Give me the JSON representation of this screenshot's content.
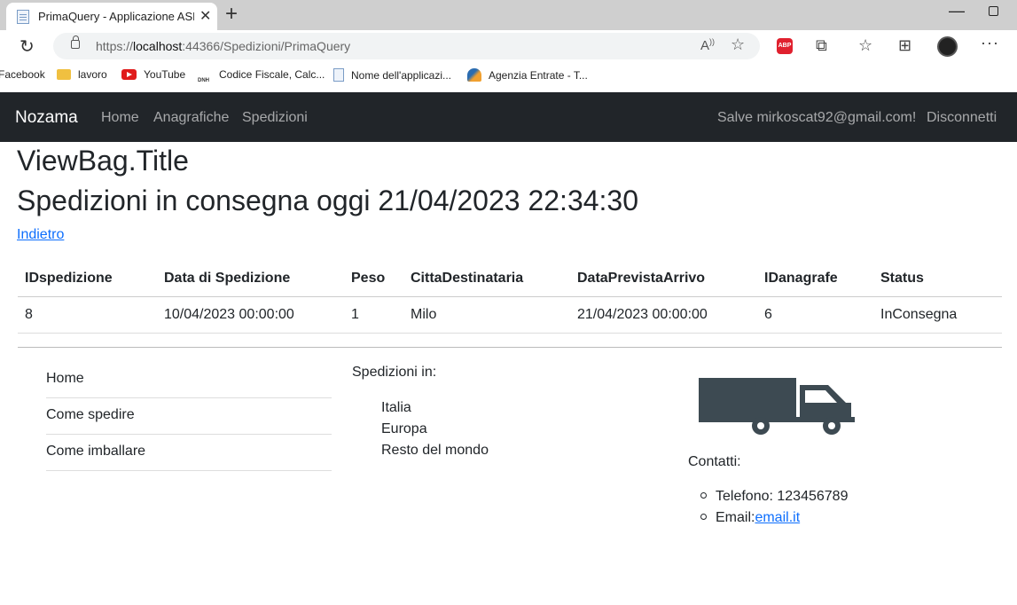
{
  "browser": {
    "tab_title": "PrimaQuery - Applicazione ASP.N",
    "url_prefix": "https://",
    "url_host": "localhost",
    "url_rest": ":44366/Spedizioni/PrimaQuery",
    "bookmarks": [
      {
        "label": "Facebook",
        "icon": "facebook-icon"
      },
      {
        "label": "lavoro",
        "icon": "folder-icon"
      },
      {
        "label": "YouTube",
        "icon": "youtube-icon"
      },
      {
        "label": "Codice Fiscale, Calc...",
        "icon": "dnh-icon"
      },
      {
        "label": "Nome dell'applicazi...",
        "icon": "document-icon"
      },
      {
        "label": "Agenzia Entrate - T...",
        "icon": "agenzia-entrate-icon"
      }
    ]
  },
  "navbar": {
    "brand": "Nozama",
    "links": [
      "Home",
      "Anagrafiche",
      "Spedizioni"
    ],
    "greeting": "Salve mirkoscat92@gmail.com!",
    "logout": "Disconnetti"
  },
  "main": {
    "title": "ViewBag.Title",
    "subtitle": "Spedizioni in consegna oggi 21/04/2023 22:34:30",
    "back_link": "Indietro",
    "table": {
      "headers": [
        "IDspedizione",
        "Data di Spedizione",
        "Peso",
        "CittaDestinataria",
        "DataPrevistaArrivo",
        "IDanagrafe",
        "Status"
      ],
      "rows": [
        [
          "8",
          "10/04/2023 00:00:00",
          "1",
          "Milo",
          "21/04/2023 00:00:00",
          "6",
          "InConsegna"
        ]
      ]
    }
  },
  "footer": {
    "nav": [
      "Home",
      "Come spedire",
      "Come imballare"
    ],
    "shipping_heading": "Spedizioni in:",
    "shipping_items": [
      "Italia",
      "Europa",
      "Resto del mondo"
    ],
    "contacts_heading": "Contatti:",
    "phone": "Telefono: 123456789",
    "email_label": "Email:",
    "email_link": "email.it"
  }
}
